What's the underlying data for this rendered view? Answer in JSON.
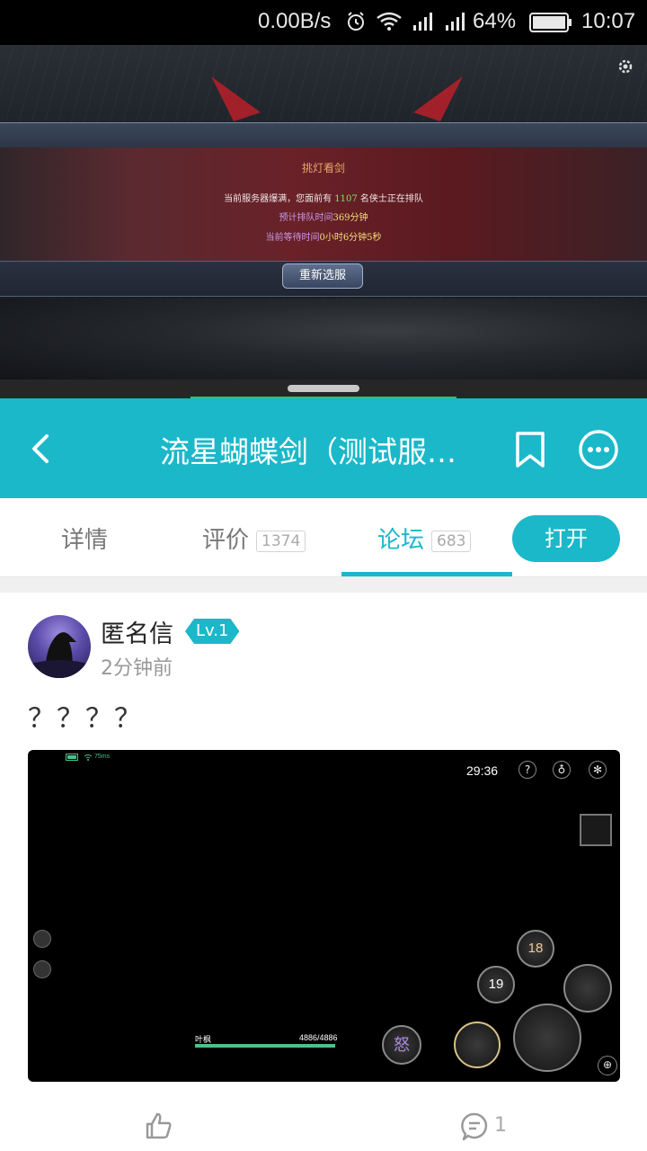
{
  "status_bar": {
    "speed": "0.00B/s",
    "battery": "64%",
    "time": "10:07"
  },
  "game": {
    "dialog_title": "挑灯看剑",
    "line1_prefix": "当前服务器爆满，您面前有 ",
    "line1_count": "1107",
    "line1_suffix": " 名侠士正在排队",
    "line2_label": "预计排队时间",
    "line2_value": "369分钟",
    "line3_label": "当前等待时间",
    "line3_value": "0小时6分钟5秒",
    "reselect_button": "重新选服"
  },
  "header": {
    "title": "流星蝴蝶剑（测试服…"
  },
  "tabs": [
    {
      "label": "详情",
      "count": ""
    },
    {
      "label": "评价",
      "count": "1374"
    },
    {
      "label": "论坛",
      "count": "683"
    }
  ],
  "open_button": "打开",
  "post": {
    "username": "匿名信",
    "level": "Lv.1",
    "time": "2分钟前",
    "text": "？？？？",
    "screenshot": {
      "ping": "75ms",
      "timer": "29:36",
      "player_name": "叶枫",
      "hp": "4886/4886",
      "skill_a": "18",
      "skill_b": "19"
    },
    "comment_count": "1"
  },
  "colors": {
    "accent": "#1bb8c9",
    "status_bar": "#000000",
    "split_handle_line": "#35c25a"
  }
}
